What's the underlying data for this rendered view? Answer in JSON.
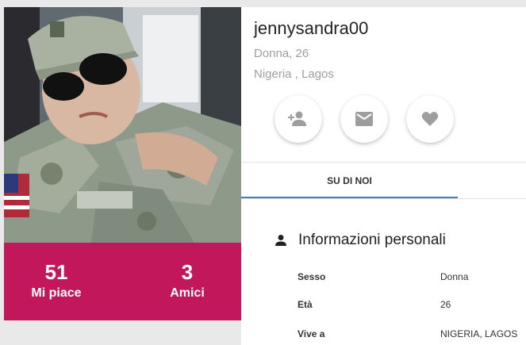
{
  "profile": {
    "username": "jennysandra00",
    "gender_age": "Donna, 26",
    "location": "Nigeria , Lagos"
  },
  "stats": {
    "likes_count": "51",
    "likes_label": "Mi piace",
    "friends_count": "3",
    "friends_label": "Amici"
  },
  "actions": [
    {
      "icon": "add-friend-icon"
    },
    {
      "icon": "mail-icon"
    },
    {
      "icon": "heart-icon"
    }
  ],
  "tabs": {
    "about_label": "SU DI NOI"
  },
  "info": {
    "title": "Informazioni personali",
    "rows": [
      {
        "label": "Sesso",
        "value": "Donna"
      },
      {
        "label": "Età",
        "value": "26"
      },
      {
        "label": "Vive a",
        "value": "NIGERIA, LAGOS"
      }
    ]
  },
  "colors": {
    "accent": "#c2185b",
    "tab_underline": "#2f82d1"
  }
}
